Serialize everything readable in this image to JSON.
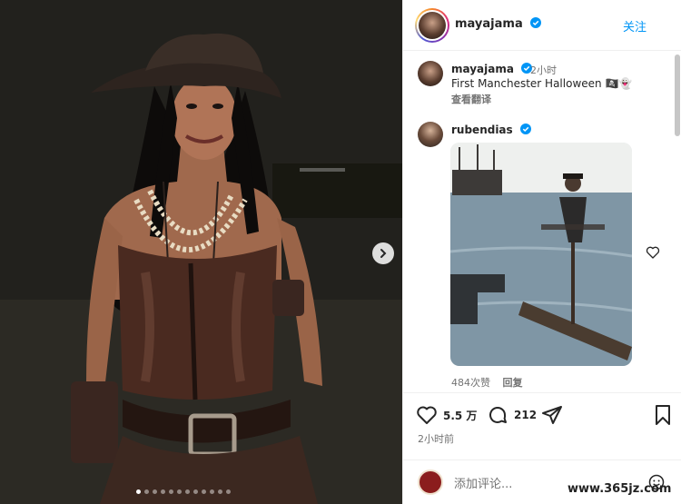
{
  "post": {
    "author": "mayajama",
    "follow_label": "关注",
    "caption_time": "2小时",
    "caption_text": "First Manchester Halloween 🏴‍☠️👻",
    "translate_label": "查看翻译",
    "likes": "5.5 万",
    "comments_count": "212",
    "posted_ago": "2小时前",
    "carousel": {
      "total_dots": 12,
      "active_dot": 0
    }
  },
  "reply": {
    "author": "rubendias",
    "likes": "484次赞",
    "reply_label": "回复"
  },
  "comment_input": {
    "placeholder": "添加评论..."
  },
  "icons": {
    "verified": "verified-badge-icon",
    "next": "chevron-right-icon",
    "like": "heart-icon",
    "comment": "comment-bubble-icon",
    "share": "paper-plane-icon",
    "save": "bookmark-icon",
    "emoji": "emoji-icon"
  },
  "colors": {
    "accent": "#0095f6",
    "verified": "#0095f6",
    "muted": "#737373"
  },
  "watermark": "www.365jz.com"
}
